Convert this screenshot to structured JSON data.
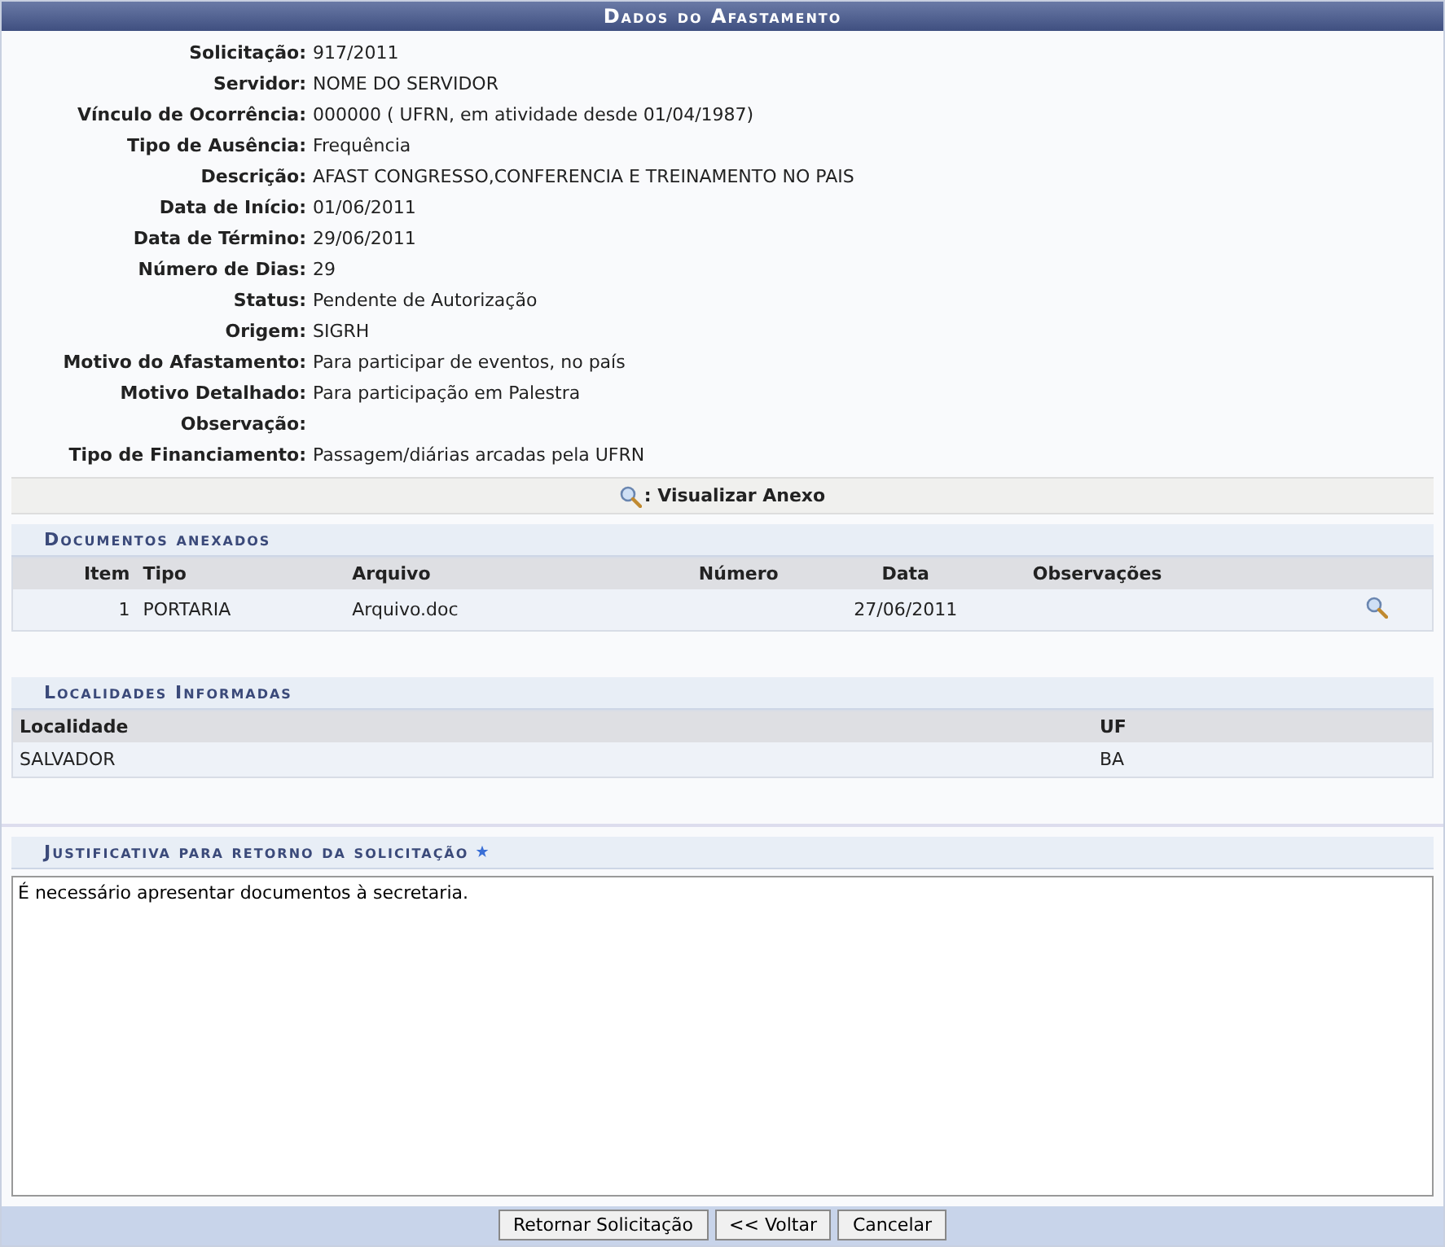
{
  "title": "Dados do Afastamento",
  "fields": [
    {
      "label": "Solicitação:",
      "value": "917/2011"
    },
    {
      "label": "Servidor:",
      "value": "NOME DO SERVIDOR"
    },
    {
      "label": "Vínculo de Ocorrência:",
      "value": "000000 ( UFRN, em atividade desde 01/04/1987)"
    },
    {
      "label": "Tipo de Ausência:",
      "value": "Frequência"
    },
    {
      "label": "Descrição:",
      "value": "AFAST CONGRESSO,CONFERENCIA E TREINAMENTO NO PAIS"
    },
    {
      "label": "Data de Início:",
      "value": "01/06/2011"
    },
    {
      "label": "Data de Término:",
      "value": "29/06/2011"
    },
    {
      "label": "Número de Dias:",
      "value": "29"
    },
    {
      "label": "Status:",
      "value": "Pendente de Autorização"
    },
    {
      "label": "Origem:",
      "value": "SIGRH"
    },
    {
      "label": "Motivo do Afastamento:",
      "value": "Para participar de eventos, no país"
    },
    {
      "label": "Motivo Detalhado:",
      "value": "Para participação em Palestra"
    },
    {
      "label": "Observação:"
    },
    {
      "label": "Tipo de Financiamento:",
      "value": "Passagem/diárias arcadas pela UFRN"
    }
  ],
  "legend": ": Visualizar Anexo",
  "documents": {
    "title": "Documentos anexados",
    "columns": [
      "Item",
      "Tipo",
      "Arquivo",
      "Número",
      "Data",
      "Observações"
    ],
    "rows": [
      {
        "item": "1",
        "tipo": "PORTARIA",
        "arquivo": "Arquivo.doc",
        "data": "27/06/2011"
      }
    ]
  },
  "locations": {
    "title": "Localidades Informadas",
    "columns": [
      "Localidade",
      "UF"
    ],
    "rows": [
      {
        "localidade": "SALVADOR",
        "uf": "BA"
      }
    ]
  },
  "justification": {
    "title": "Justificativa para retorno da solicitação",
    "required": true,
    "value": "É necessário apresentar documentos à secretaria."
  },
  "buttons": [
    "Retornar Solicitação",
    "<< Voltar",
    "Cancelar"
  ]
}
